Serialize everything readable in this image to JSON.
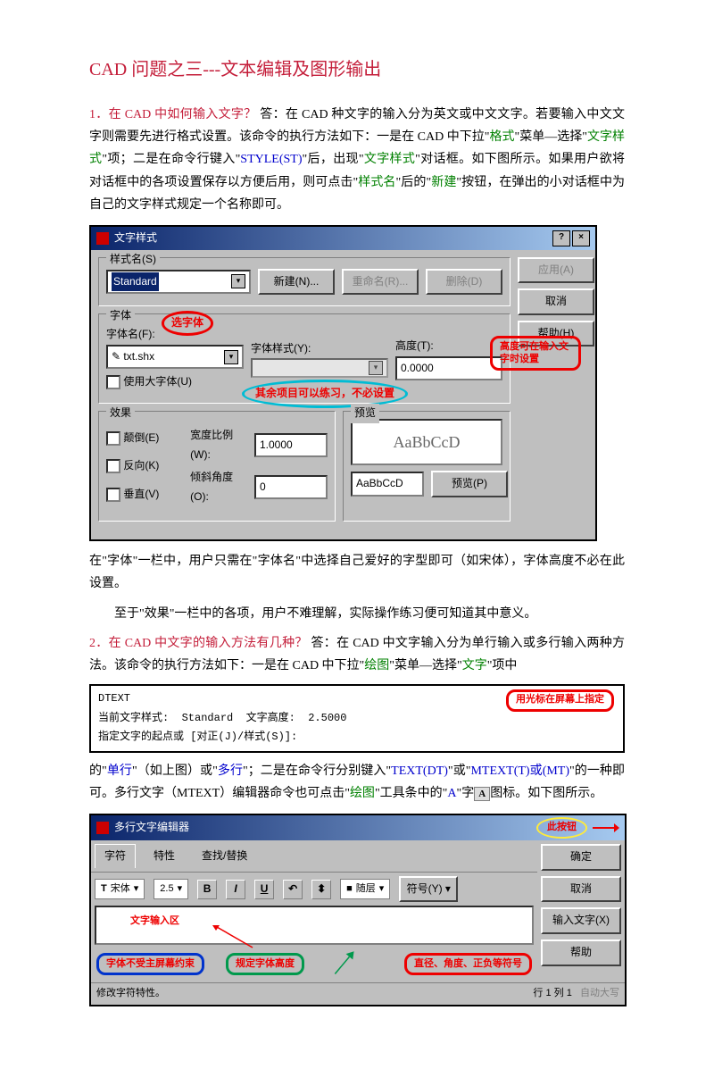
{
  "title": "CAD 问题之三---文本编辑及图形输出",
  "section1": {
    "q": "1．在 CAD 中如何输入文字？",
    "a_pre": "  答：在 CAD 种文字的输入分为英文或中文文字。若要输入中文文字则需要先进行格式设置。该命令的执行方法如下：一是在 CAD 中下拉\"",
    "a_green1": "格式",
    "a_mid1": "\"菜单—选择\"",
    "a_green2": "文字样式",
    "a_mid2": "\"项；二是在命令行键入\"",
    "a_blue1": "STYLE(ST)",
    "a_mid3": "\"后，出现\"",
    "a_green3": "文字样式",
    "a_mid4": "\"对话框。如下图所示。如果用户欲将对话框中的各项设置保存以方便后用，则可点击\"",
    "a_green4": "样式名",
    "a_mid5": "\"后的\"",
    "a_green5": "新建",
    "a_end": "\"按钮，在弹出的小对话框中为自己的文字样式规定一个名称即可。"
  },
  "dlg1": {
    "title": "文字样式",
    "close_help": "?",
    "close_x": "×",
    "group_style": "样式名(S)",
    "style_value": "Standard",
    "btn_new": "新建(N)...",
    "btn_rename": "重命名(R)...",
    "btn_delete": "删除(D)",
    "btn_apply": "应用(A)",
    "btn_cancel": "取消",
    "btn_help": "帮助(H)",
    "group_font": "字体",
    "font_name_label": "字体名(F):",
    "font_value": "txt.shx",
    "font_style_label": "字体样式(Y):",
    "height_label": "高度(T):",
    "height_value": "0.0000",
    "big_font": "使用大字体(U)",
    "callout_selectfont": "选字体",
    "callout_other": "其余项目可以练习，不必设置",
    "callout_height": "高度可在输入文字时设置",
    "group_effect": "效果",
    "upside": "颠倒(E)",
    "backward": "反向(K)",
    "vertical": "垂直(V)",
    "width_label": "宽度比例(W):",
    "width_value": "1.0000",
    "oblique_label": "倾斜角度(O):",
    "oblique_value": "0",
    "group_preview": "预览",
    "preview_text": "AaBbCcD",
    "preview_input": "AaBbCcD",
    "btn_preview": "预览(P)"
  },
  "para_after_dlg1": {
    "l1": "在\"字体\"一栏中，用户只需在\"字体名\"中选择自己爱好的字型即可（如宋体），字体高度不必在此设置。",
    "l2": "至于\"效果\"一栏中的各项，用户不难理解，实际操作练习便可知道其中意义。"
  },
  "section2": {
    "q": "2．在 CAD 中文字的输入方法有几种？",
    "a_pre": "  答：在 CAD 中文字输入分为单行输入或多行输入两种方法。该命令的执行方法如下：一是在 CAD 中下拉\"",
    "a_green1": "绘图",
    "a_mid1": "\"菜单—选择\"",
    "a_green2": "文字",
    "a_end": "\"项中"
  },
  "cmd": {
    "l1a": "DTEXT",
    "l1b": "当前文字样式:",
    "l1c": "Standard",
    "l1d": "文字高度:",
    "l1e": "2.5000",
    "l2": "指定文字的起点或 [对正(J)/样式(S)]:",
    "callout": "用光标在屏幕上指定"
  },
  "para_after_cmd": {
    "pre": "的\"",
    "blue1": "单行",
    "mid1": "\"（如上图）或\"",
    "blue2": "多行",
    "mid2": "\"；二是在命令行分别键入\"",
    "blue3": "TEXT(DT)",
    "mid3": "\"或\"",
    "blue4": "MTEXT(T)或(MT)",
    "mid4": "\"的一种即可。多行文字（MTEXT）编辑器命令也可点击\"",
    "green1": "绘图",
    "mid5": "\"工具条中的\"",
    "blue5": "A",
    "mid6": "\"字",
    "end": "图标。如下图所示。"
  },
  "dlg2": {
    "title": "多行文字编辑器",
    "tab1": "字符",
    "tab2": "特性",
    "tab3": "查找/替换",
    "font": "宋体",
    "size": "2.5",
    "bold": "B",
    "italic": "I",
    "under": "U",
    "layer": "随层",
    "symbol": "符号(Y)",
    "btn_ok": "确定",
    "btn_cancel": "取消",
    "btn_import": "输入文字(X)",
    "btn_help": "帮助",
    "callout_btn": "此按钮",
    "callout_input": "文字输入区",
    "callout_scroll": "字体不受主屏幕约束",
    "callout_height": "规定字体高度",
    "callout_symbol": "直径、角度、正负等符号",
    "status_left": "修改字符特性。",
    "status_mid": "行 1 列 1",
    "status_right": "自动大写"
  },
  "icon_A": "A"
}
